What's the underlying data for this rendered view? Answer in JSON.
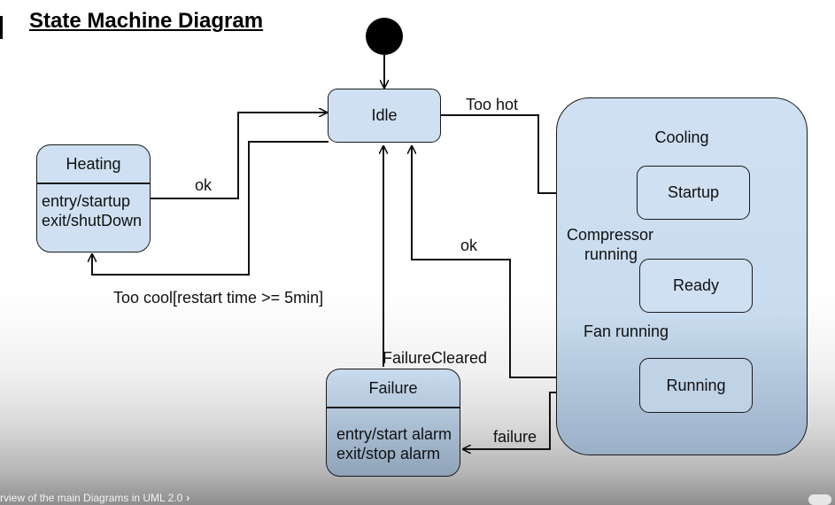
{
  "diagram": {
    "title": "State Machine Diagram",
    "states": {
      "idle": "Idle",
      "heating": {
        "name": "Heating",
        "entry": "entry/startup",
        "exit": "exit/shutDown"
      },
      "cooling": "Cooling",
      "startup": "Startup",
      "ready": "Ready",
      "running": "Running",
      "failure": {
        "name": "Failure",
        "entry": "entry/start alarm",
        "exit": "exit/stop alarm"
      }
    },
    "transitions": {
      "too_hot": "Too hot",
      "ok_heating": "ok",
      "too_cool": "Too cool[restart time >= 5min]",
      "ok_running": "ok",
      "compressor_1": "Compressor",
      "compressor_2": "running",
      "fan_running": "Fan running",
      "failure_cleared": "FailureCleared",
      "failure": "failure"
    }
  },
  "video_bar": {
    "caption": "rview of the main Diagrams in UML 2.0",
    "chevron": "›"
  }
}
